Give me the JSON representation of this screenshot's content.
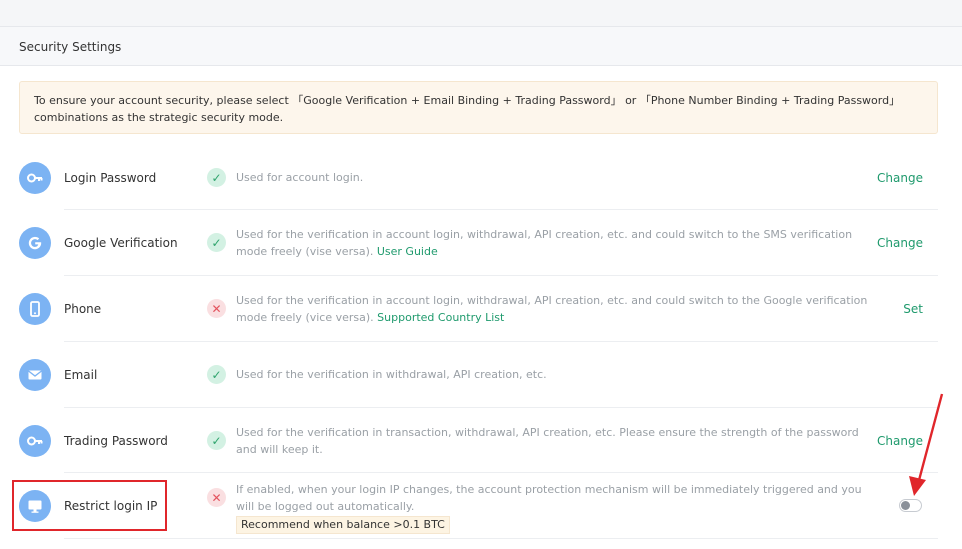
{
  "page": {
    "section_title": "Security Settings",
    "notice": "To ensure your account security, please select 「Google Verification + Email Binding + Trading Password」 or 「Phone Number Binding + Trading Password」 combinations as the strategic security mode."
  },
  "colors": {
    "accent_green": "#1f9a6d",
    "avatar_blue": "#7cb3f3",
    "ok_green": "#2fa46d",
    "fail_red": "#e3525d",
    "annotation_red": "#e0262b"
  },
  "rows": [
    {
      "label": "Login Password",
      "icon": "key-icon",
      "status": "enabled",
      "desc": "Used for account login.",
      "link": "",
      "action": "Change"
    },
    {
      "label": "Google Verification",
      "icon": "google-icon",
      "status": "enabled",
      "desc": "Used for the verification in account login, withdrawal, API creation, etc. and could switch to the SMS verification mode freely (vise versa).",
      "link": "User Guide",
      "action": "Change"
    },
    {
      "label": "Phone",
      "icon": "phone-icon",
      "status": "disabled",
      "desc": "Used for the verification in account login, withdrawal, API creation, etc. and could switch to the Google verification mode freely (vice versa).",
      "link": "Supported Country List",
      "action": "Set"
    },
    {
      "label": "Email",
      "icon": "mail-icon",
      "status": "enabled",
      "desc": "Used for the verification in withdrawal, API creation, etc.",
      "link": "",
      "action": ""
    },
    {
      "label": "Trading Password",
      "icon": "key-icon",
      "status": "enabled",
      "desc": "Used for the verification in transaction, withdrawal, API creation, etc. Please ensure the strength of the password and will keep it.",
      "link": "",
      "action": "Change"
    },
    {
      "label": "Restrict login IP",
      "icon": "monitor-icon",
      "status": "disabled",
      "desc": "If enabled, when your login IP changes, the account protection mechanism will be immediately triggered and you will be logged out automatically.",
      "badge": "Recommend when balance >0.1 BTC",
      "toggle_on": false
    }
  ]
}
